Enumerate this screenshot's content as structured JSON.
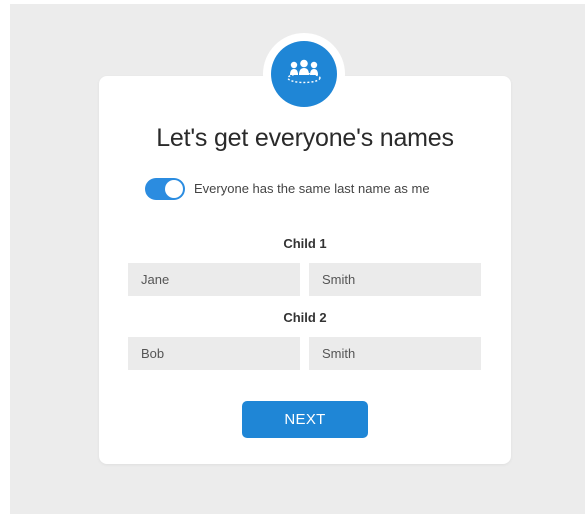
{
  "header": {
    "icon": "group-people-icon",
    "title": "Let's get everyone's names"
  },
  "toggle": {
    "label": "Everyone has the same last name as me",
    "on": true
  },
  "children": [
    {
      "label": "Child 1",
      "first_name": "Jane",
      "last_name": "Smith"
    },
    {
      "label": "Child 2",
      "first_name": "Bob",
      "last_name": "Smith"
    }
  ],
  "actions": {
    "next_label": "NEXT"
  },
  "colors": {
    "accent": "#1f86d6",
    "field_bg": "#ebebeb",
    "backdrop": "#ececec"
  }
}
